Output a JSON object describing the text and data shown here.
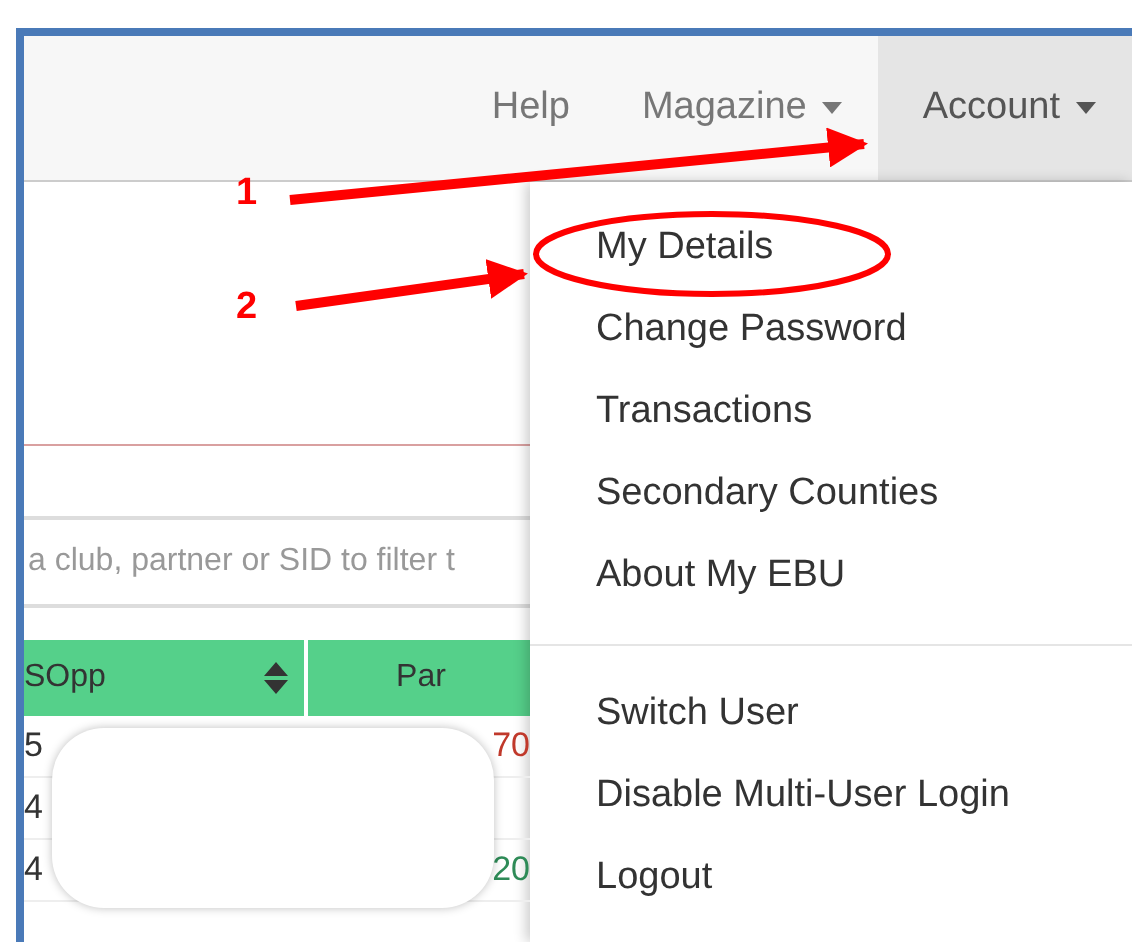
{
  "navbar": {
    "items": [
      {
        "label": "Help",
        "kind": "link",
        "selected": false
      },
      {
        "label": "Magazine",
        "kind": "dropdown",
        "selected": false
      },
      {
        "label": "Account",
        "kind": "dropdown",
        "selected": true
      }
    ]
  },
  "filter": {
    "placeholder": "a club, partner or SID to filter t"
  },
  "table": {
    "columns": [
      "SOpp",
      "Par"
    ],
    "rows": [
      {
        "cells": [
          {
            "text": "5"
          },
          {
            "text": "70",
            "color": "#c0392b"
          }
        ]
      },
      {
        "cells": [
          {
            "text": "4"
          }
        ]
      },
      {
        "cells": [
          {
            "text": "4"
          },
          {
            "text": "20",
            "color": "#2e8b57"
          }
        ]
      }
    ]
  },
  "account_menu": {
    "sections": [
      {
        "items": [
          {
            "label": "My Details",
            "circled": true
          },
          {
            "label": "Change Password",
            "circled": false
          },
          {
            "label": "Transactions",
            "circled": false
          },
          {
            "label": "Secondary Counties",
            "circled": false
          },
          {
            "label": "About My EBU",
            "circled": false
          }
        ]
      },
      {
        "items": [
          {
            "label": "Switch User",
            "circled": false
          },
          {
            "label": "Disable Multi-User Login",
            "circled": false
          },
          {
            "label": "Logout",
            "circled": false
          }
        ]
      }
    ]
  },
  "annotations": [
    {
      "label": "1"
    },
    {
      "label": "2"
    }
  ]
}
